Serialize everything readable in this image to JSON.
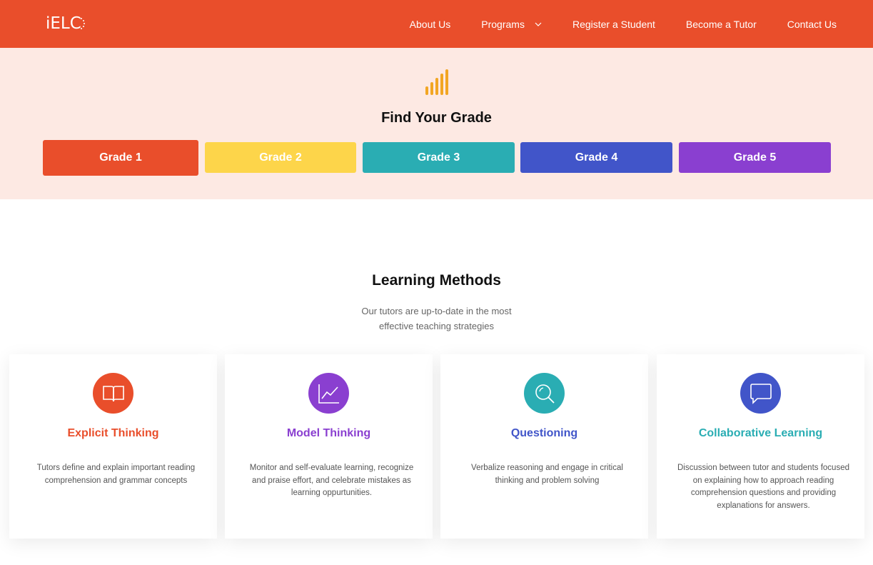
{
  "header": {
    "logo_text": "iELC",
    "nav": [
      {
        "label": "About Us"
      },
      {
        "label": "Programs"
      },
      {
        "label": "Register a Student"
      },
      {
        "label": "Become a Tutor"
      },
      {
        "label": "Contact Us"
      }
    ]
  },
  "grades": {
    "title": "Find Your Grade",
    "icon": "signal-bars-icon",
    "buttons": [
      {
        "label": "Grade 1",
        "color": "#e94e2b"
      },
      {
        "label": "Grade 2",
        "color": "#fdd54a"
      },
      {
        "label": "Grade 3",
        "color": "#2aadb3"
      },
      {
        "label": "Grade 4",
        "color": "#4155c9"
      },
      {
        "label": "Grade 5",
        "color": "#8a3fd0"
      }
    ]
  },
  "learning_methods": {
    "title": "Learning Methods",
    "subtitle": "Our tutors are up-to-date in the most effective teaching strategies",
    "cards": [
      {
        "title": "Explicit Thinking",
        "icon": "open-book-icon",
        "color": "#e94e2b",
        "text": "Tutors define and explain important reading comprehension and grammar concepts"
      },
      {
        "title": "Model Thinking",
        "icon": "line-chart-icon",
        "color": "#8a3fd0",
        "text": "Monitor and self-evaluate learning, recognize and praise effort, and celebrate mistakes as learning oppurtunities."
      },
      {
        "title": "Questioning",
        "icon": "magnifier-icon",
        "color": "#2aadb3",
        "title_color": "#4155c9",
        "text": "Verbalize reasoning and engage in critical thinking and problem solving"
      },
      {
        "title": "Collaborative Learning",
        "icon": "chat-bubble-icon",
        "color": "#4155c9",
        "title_color": "#2aadb3",
        "text": "Discussion between tutor and students focused on explaining how to approach reading comprehension questions and providing explanations for answers."
      }
    ]
  }
}
